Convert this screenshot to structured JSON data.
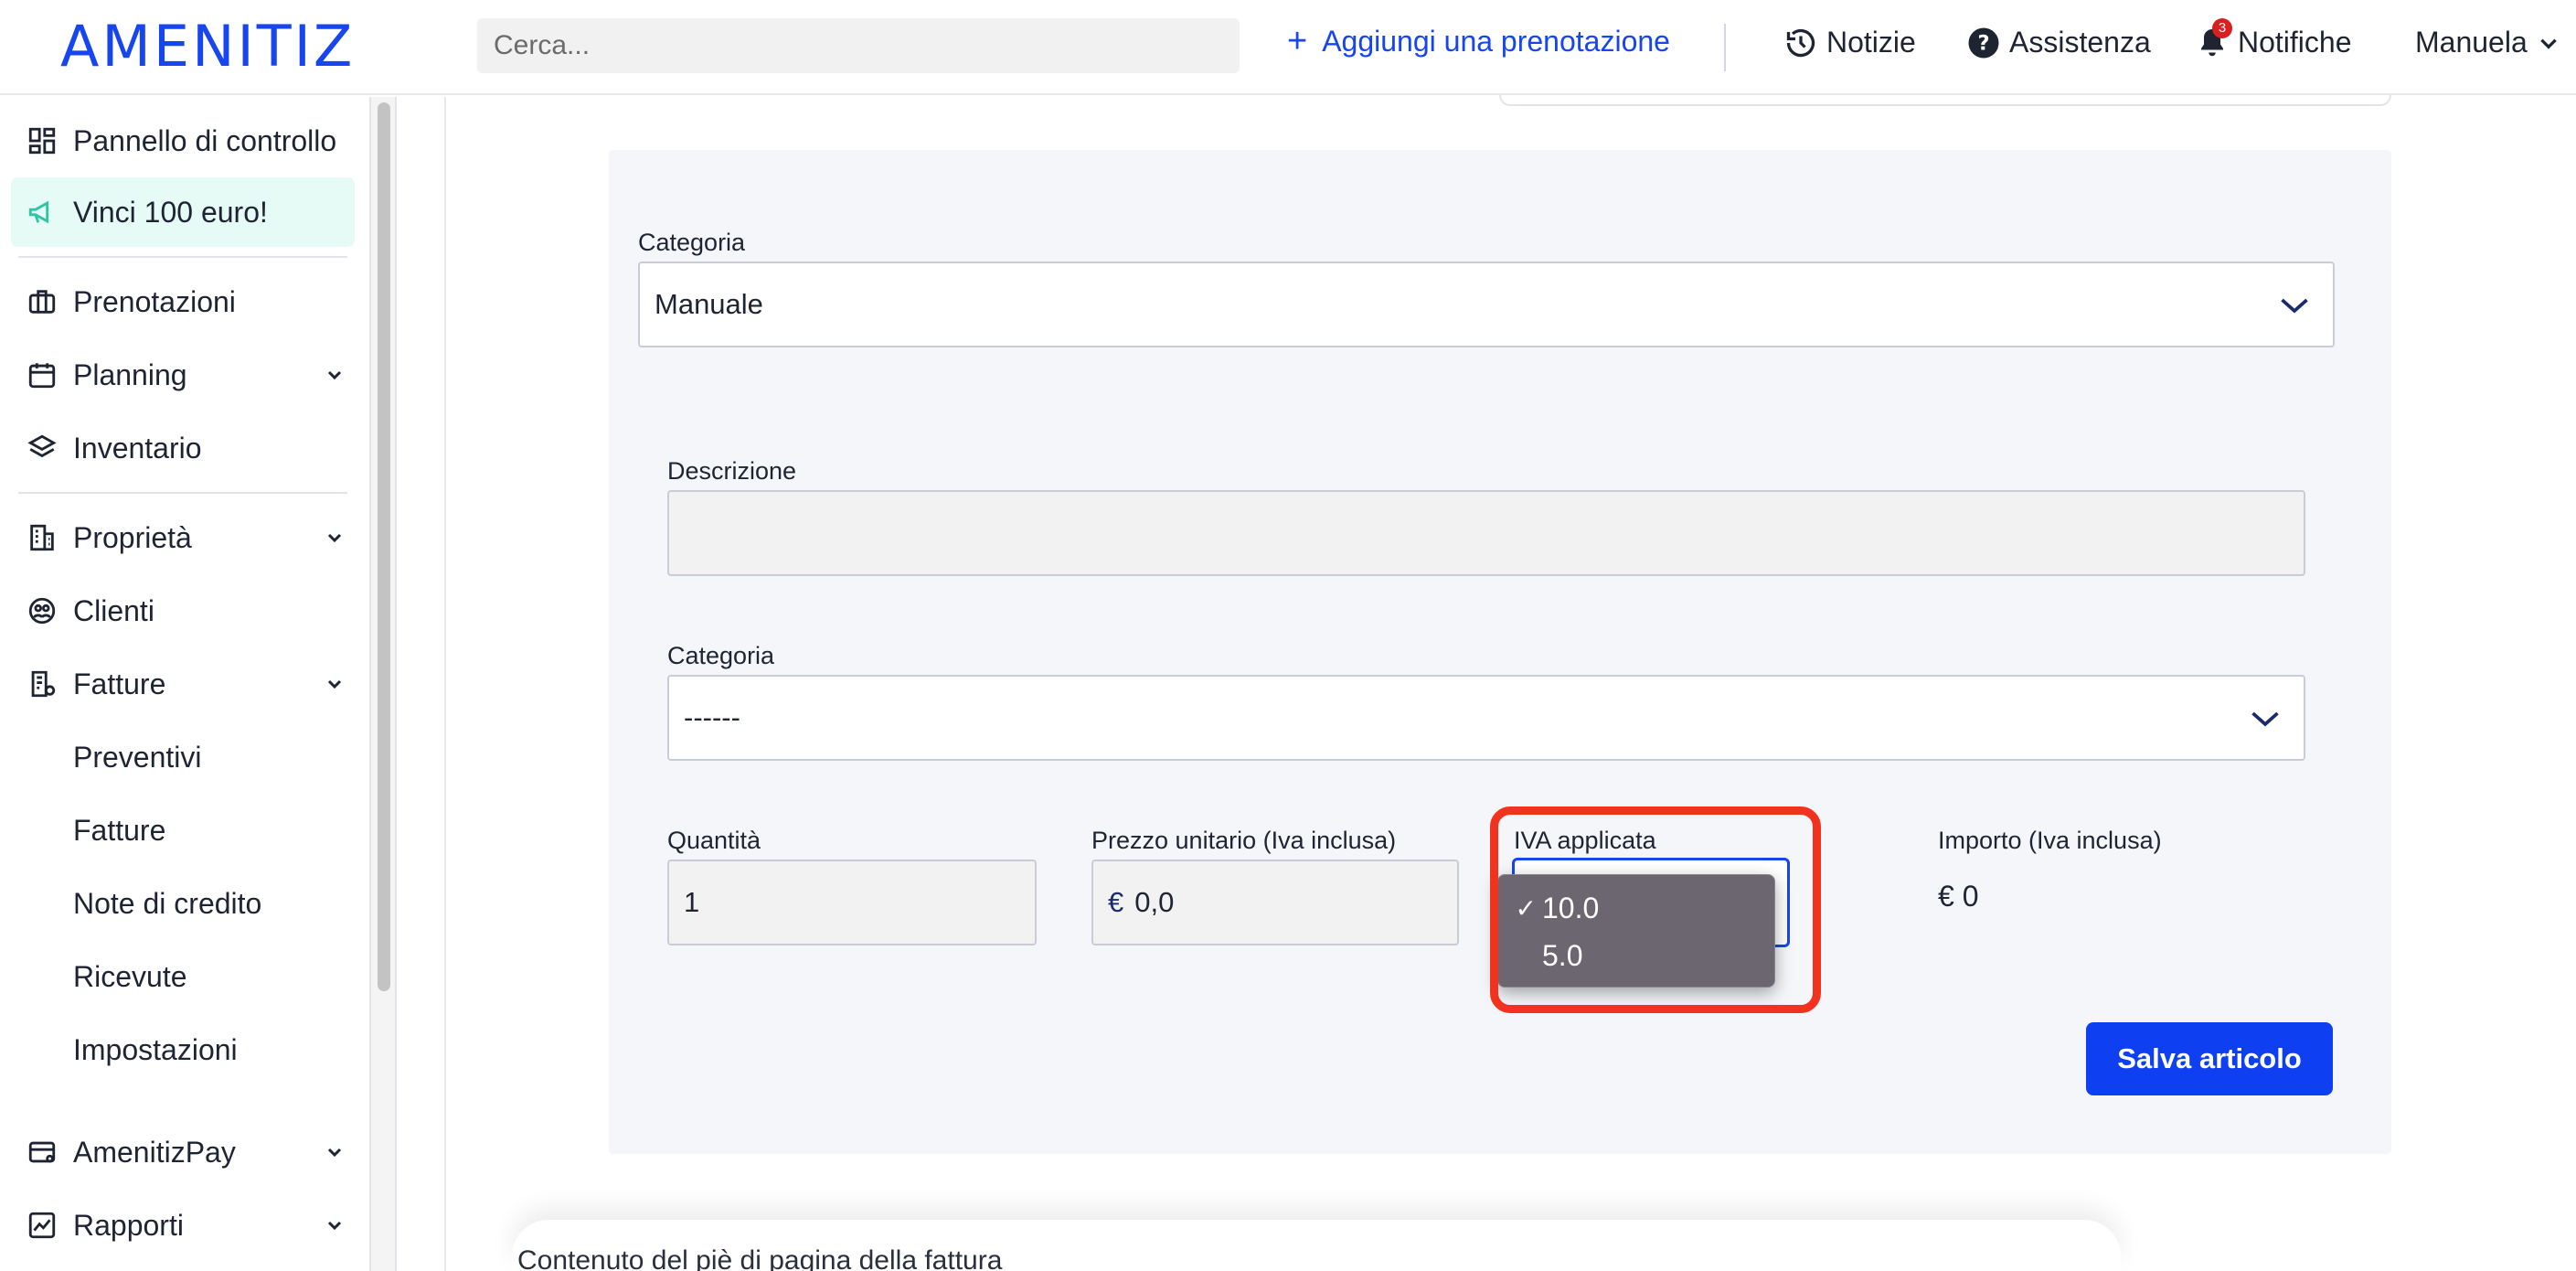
{
  "header": {
    "logo": "AMENITIZ",
    "search_placeholder": "Cerca...",
    "add_booking": "Aggiungi una prenotazione",
    "news": "Notizie",
    "help": "Assistenza",
    "notifications": "Notifiche",
    "notifications_count": "3",
    "user": "Manuela"
  },
  "sidebar": {
    "items": [
      {
        "label": "Pannello di controllo",
        "icon": "dashboard-icon"
      },
      {
        "label": "Vinci 100 euro!",
        "icon": "megaphone-icon"
      },
      {
        "label": "Prenotazioni",
        "icon": "suitcase-icon"
      },
      {
        "label": "Planning",
        "icon": "calendar-icon"
      },
      {
        "label": "Inventario",
        "icon": "layers-icon"
      },
      {
        "label": "Proprietà",
        "icon": "building-icon"
      },
      {
        "label": "Clienti",
        "icon": "guests-icon"
      },
      {
        "label": "Fatture",
        "icon": "invoice-icon"
      },
      {
        "label": "Preventivi"
      },
      {
        "label": "Fatture"
      },
      {
        "label": "Note di credito"
      },
      {
        "label": "Ricevute"
      },
      {
        "label": "Impostazioni"
      },
      {
        "label": "AmenitizPay",
        "icon": "card-icon"
      },
      {
        "label": "Rapporti",
        "icon": "chart-icon"
      }
    ]
  },
  "form": {
    "category_top_label": "Categoria",
    "category_top_value": "Manuale",
    "description_label": "Descrizione",
    "description_value": "",
    "category_label": "Categoria",
    "category_value": "------",
    "quantity_label": "Quantità",
    "quantity_value": "1",
    "unit_price_label": "Prezzo unitario (Iva inclusa)",
    "currency": "€",
    "unit_price_value": "0,0",
    "vat_label": "IVA applicata",
    "vat_options": [
      "10.0",
      "5.0"
    ],
    "vat_selected": "10.0",
    "amount_label": "Importo (Iva inclusa)",
    "amount_value": "€ 0",
    "save_button": "Salva articolo"
  },
  "footer": {
    "invoice_footer_label": "Contenuto del piè di pagina della fattura"
  },
  "colors": {
    "brand": "#1745f0",
    "highlight": "#f0321e",
    "panel": "#f5f6fa"
  }
}
